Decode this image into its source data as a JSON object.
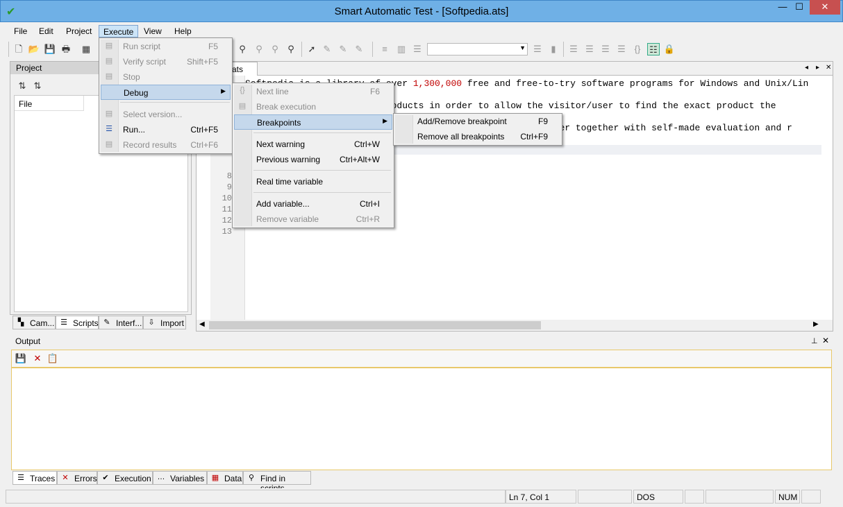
{
  "window": {
    "title": "Smart Automatic Test - [Softpedia.ats]",
    "minimize": "—",
    "maximize": "☐",
    "close": "✕"
  },
  "menubar": [
    "File",
    "Edit",
    "Project",
    "Execute",
    "View",
    "Help"
  ],
  "project_panel": {
    "title": "Project",
    "column": "File",
    "tabs": [
      "Cam...",
      "Scripts",
      "Interf...",
      "Import"
    ]
  },
  "editor": {
    "tab_label": "ats",
    "tab_nav": [
      "◂",
      "▸",
      "✕"
    ],
    "line_numbers": [
      "8",
      "9",
      "10",
      "11",
      "12",
      "13"
    ],
    "lines": [
      {
        "pre": "Softpedia is a library of over ",
        "num": "1,300,000",
        "post": " free and free-to-try software programs for Windows and Unix/Lin"
      },
      {
        "pre": "                     ese products in order to allow the visitor/user to find the exact product the",
        "num": "",
        "post": ""
      },
      {
        "pre": "                                                      r/user together with self-made evaluation and r",
        "num": "",
        "post": ""
      }
    ]
  },
  "output": {
    "title": "Output",
    "tabs": [
      "Traces",
      "Errors",
      "Execution",
      "Variables",
      "Data",
      "Find in scripts"
    ]
  },
  "statusbar": {
    "position": "Ln 7, Col 1",
    "encoding": "DOS",
    "num": "NUM"
  },
  "execute_menu": [
    {
      "label": "Run script",
      "accel": "F5",
      "disabled": true,
      "icon": "run-script-icon"
    },
    {
      "label": "Verify script",
      "accel": "Shift+F5",
      "disabled": true,
      "icon": "verify-script-icon"
    },
    {
      "label": "Stop",
      "accel": "",
      "disabled": true,
      "icon": "stop-icon"
    },
    {
      "label": "Debug",
      "accel": "",
      "disabled": false,
      "icon": "",
      "submenu": true
    },
    {
      "label": "Select version...",
      "accel": "",
      "disabled": true,
      "icon": "select-version-icon"
    },
    {
      "label": "Run...",
      "accel": "Ctrl+F5",
      "disabled": false,
      "icon": "run-icon"
    },
    {
      "label": "Record results",
      "accel": "Ctrl+F6",
      "disabled": true,
      "icon": "record-results-icon"
    }
  ],
  "debug_menu": [
    {
      "label": "Next line",
      "accel": "F6",
      "disabled": true
    },
    {
      "label": "Break execution",
      "accel": "",
      "disabled": true
    },
    {
      "label": "Breakpoints",
      "accel": "",
      "disabled": false,
      "submenu": true
    },
    {
      "label": "Next warning",
      "accel": "Ctrl+W",
      "disabled": false
    },
    {
      "label": "Previous warning",
      "accel": "Ctrl+Alt+W",
      "disabled": false
    },
    {
      "label": "Real time variable",
      "accel": "",
      "disabled": false
    },
    {
      "label": "Add variable...",
      "accel": "Ctrl+I",
      "disabled": false
    },
    {
      "label": "Remove variable",
      "accel": "Ctrl+R",
      "disabled": true
    }
  ],
  "breakpoints_menu": [
    {
      "label": "Add/Remove breakpoint",
      "accel": "F9"
    },
    {
      "label": "Remove all breakpoints",
      "accel": "Ctrl+F9"
    }
  ],
  "colors": {
    "titlebar": "#6fb0e6",
    "menu_highlight": "#c5d8ec",
    "output_border": "#e8c86a",
    "close_button": "#c75050"
  }
}
